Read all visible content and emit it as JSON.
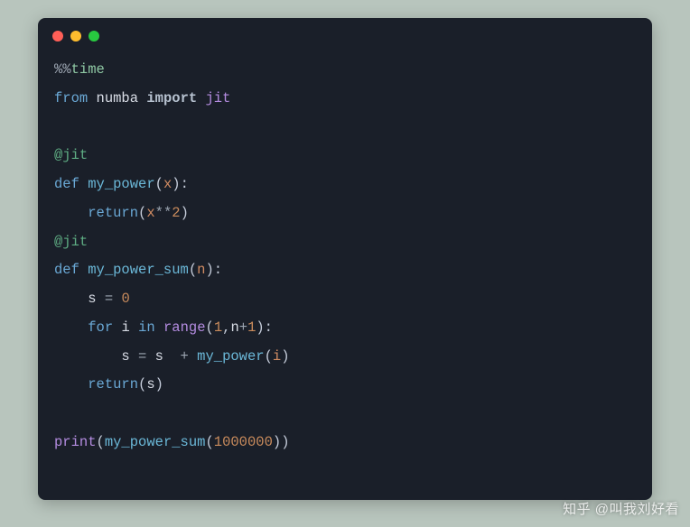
{
  "code": {
    "line1": {
      "pct": "%%",
      "magic": "time"
    },
    "line2": {
      "from": "from",
      "mod": "numba",
      "import": "import",
      "name": "jit"
    },
    "line4": {
      "dec": "@jit"
    },
    "line5": {
      "def": "def",
      "fn": "my_power",
      "lp": "(",
      "p": "x",
      "rp": "):"
    },
    "line6": {
      "ret": "return",
      "lp": "(",
      "v": "x",
      "op": "**",
      "n": "2",
      "rp": ")"
    },
    "line7": {
      "dec": "@jit"
    },
    "line8": {
      "def": "def",
      "fn": "my_power_sum",
      "lp": "(",
      "p": "n",
      "rp": "):"
    },
    "line9": {
      "v": "s",
      "eq": " = ",
      "n": "0"
    },
    "line10": {
      "for": "for",
      "i": "i",
      "in": "in",
      "range": "range",
      "lp": "(",
      "a": "1",
      "c": ",",
      "b": "n",
      "plus": "+",
      "d": "1",
      "rp": "):"
    },
    "line11": {
      "s1": "s",
      "eq": " = ",
      "s2": "s",
      "plus": "  + ",
      "fn": "my_power",
      "lp": "(",
      "i": "i",
      "rp": ")"
    },
    "line12": {
      "ret": "return",
      "lp": "(",
      "v": "s",
      "rp": ")"
    },
    "line14": {
      "print": "print",
      "lp1": "(",
      "fn": "my_power_sum",
      "lp2": "(",
      "n": "1000000",
      "rp": "))"
    }
  },
  "watermark": "知乎 @叫我刘好看",
  "watermark2": ""
}
